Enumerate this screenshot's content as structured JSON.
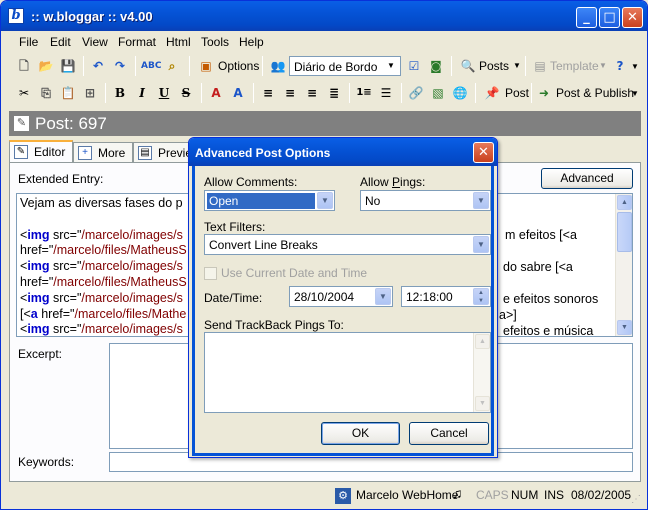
{
  "window": {
    "title": ":: w.bloggar :: v4.00",
    "app_icon": "b"
  },
  "menu": [
    "File",
    "Edit",
    "View",
    "Format",
    "Html",
    "Tools",
    "Help"
  ],
  "toolbar1": {
    "options_label": "Options",
    "blog_name": "Diário de Bordo",
    "posts_label": "Posts",
    "template_label": "Template"
  },
  "toolbar2": {
    "post_label": "Post",
    "post_publish_label": "Post & Publish"
  },
  "post_header": "Post: 697",
  "tabs": {
    "editor": "Editor",
    "more": "More",
    "preview": "Previe"
  },
  "extended_entry_label": "Extended Entry:",
  "advanced_button": "Advanced",
  "editor": {
    "line1": "Vejam as diversas fases do p",
    "lines": [
      {
        "p1": "<",
        "tag": "img",
        "p2": " src=\"",
        "str": "/marcelo/images/s"
      },
      {
        "p1": "href=\"",
        "str": "/marcelo/files/MatheusS"
      },
      {
        "p1": "<",
        "tag": "img",
        "p2": " src=\"",
        "str": "/marcelo/images/s"
      },
      {
        "p1": "href=\"",
        "str": "/marcelo/files/MatheusS"
      },
      {
        "p1": "<",
        "tag": "img",
        "p2": " src=\"",
        "str": "/marcelo/images/s"
      },
      {
        "p1": "[<",
        "tag": "a",
        "p2": " href=\"",
        "str": "/marcelo/files/Mathe"
      },
      {
        "p1": "<",
        "tag": "img",
        "p2": " src=\"",
        "str": "/marcelo/images/s"
      }
    ],
    "right_fragments": [
      "m efeitos [<a",
      "do sabre [<a",
      "e efeitos sonoros",
      "a>]",
      "efeitos e música"
    ]
  },
  "excerpt_label": "Excerpt:",
  "keywords_label": "Keywords:",
  "status": {
    "user": "Marcelo WebHome",
    "caps": "CAPS",
    "num": "NUM",
    "ins": "INS",
    "date": "08/02/2005"
  },
  "dialog": {
    "title": "Advanced Post Options",
    "allow_comments_label": "Allow Comments:",
    "allow_comments_value": "Open",
    "allow_pings_label": "Allow Pings:",
    "allow_pings_value": "No",
    "text_filters_label": "Text Filters:",
    "text_filters_value": "Convert Line Breaks",
    "use_current_label": "Use Current Date and Time",
    "datetime_label": "Date/Time:",
    "date_value": "28/10/2004",
    "time_value": "12:18:00",
    "trackback_label": "Send TrackBack Pings To:",
    "ok": "OK",
    "cancel": "Cancel"
  }
}
